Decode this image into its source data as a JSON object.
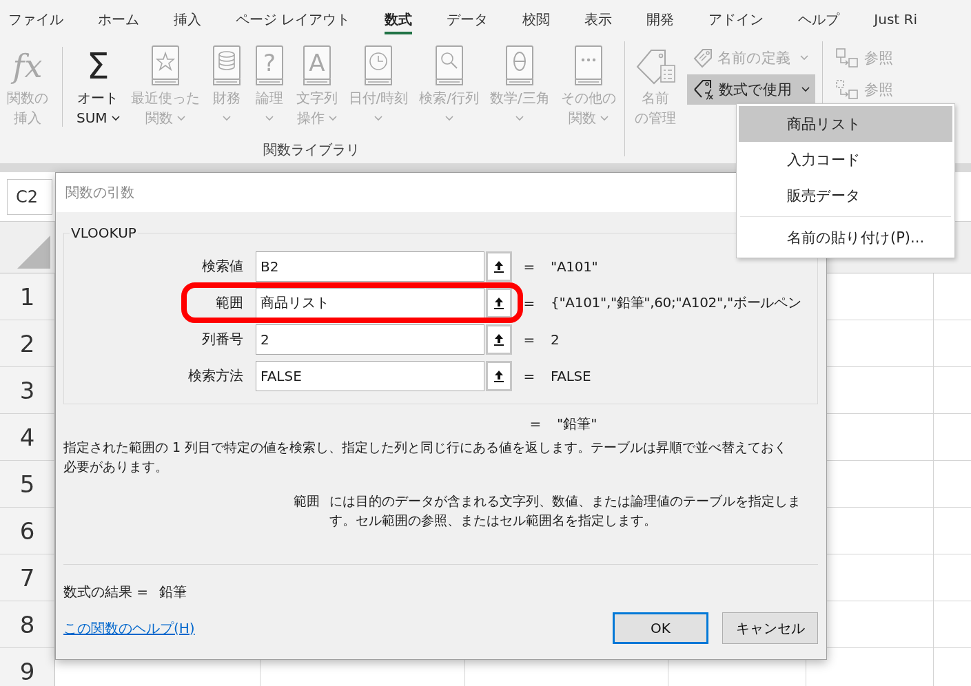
{
  "ribbon_tabs": [
    {
      "label": "ファイル",
      "selected": false
    },
    {
      "label": "ホーム",
      "selected": false
    },
    {
      "label": "挿入",
      "selected": false
    },
    {
      "label": "ページ レイアウト",
      "selected": false
    },
    {
      "label": "数式",
      "selected": true
    },
    {
      "label": "データ",
      "selected": false
    },
    {
      "label": "校閲",
      "selected": false
    },
    {
      "label": "表示",
      "selected": false
    },
    {
      "label": "開発",
      "selected": false
    },
    {
      "label": "アドイン",
      "selected": false
    },
    {
      "label": "ヘルプ",
      "selected": false
    },
    {
      "label": "Just Ri",
      "selected": false
    }
  ],
  "ribbon_groups": [
    {
      "label": "関数ライブラリ",
      "commands": [
        {
          "kind": "large",
          "glyph": "fx",
          "lines": [
            "関数の",
            "挿入"
          ],
          "disabled": true,
          "dropdown": false,
          "pressed": false,
          "separator_after": true
        },
        {
          "kind": "large",
          "glyph": "Σ",
          "lines": [
            "オート",
            "SUM"
          ],
          "disabled": false,
          "dropdown": true,
          "pressed": false,
          "separator_after": false
        },
        {
          "kind": "large",
          "lines": [
            "最近使った",
            "関数"
          ],
          "disabled": true,
          "dropdown": true,
          "pressed": false,
          "separator_after": false
        },
        {
          "kind": "large",
          "lines": [
            "財務"
          ],
          "disabled": true,
          "dropdown": true,
          "pressed": false,
          "separator_after": false
        },
        {
          "kind": "large",
          "glyph": "?",
          "lines": [
            "論理"
          ],
          "disabled": true,
          "dropdown": true,
          "pressed": false,
          "separator_after": false
        },
        {
          "kind": "large",
          "glyph": "A",
          "lines": [
            "文字列",
            "操作"
          ],
          "disabled": true,
          "dropdown": true,
          "pressed": false,
          "separator_after": false
        },
        {
          "kind": "large",
          "lines": [
            "日付/時刻"
          ],
          "disabled": true,
          "dropdown": true,
          "pressed": false,
          "separator_after": false
        },
        {
          "kind": "large",
          "lines": [
            "検索/行列"
          ],
          "disabled": true,
          "dropdown": true,
          "pressed": false,
          "separator_after": false
        },
        {
          "kind": "large",
          "lines": [
            "数学/三角"
          ],
          "disabled": true,
          "dropdown": true,
          "pressed": false,
          "separator_after": false
        },
        {
          "kind": "large",
          "lines": [
            "その他の",
            "関数"
          ],
          "disabled": true,
          "dropdown": true,
          "pressed": false,
          "separator_after": false
        }
      ]
    },
    {
      "commands": [
        {
          "kind": "large",
          "lines": [
            "名前",
            "の管理"
          ],
          "disabled": true,
          "dropdown": false,
          "pressed": false,
          "separator_after": false
        },
        {
          "kind": "small",
          "lines": [
            "名前の定義"
          ],
          "disabled": true,
          "dropdown": true,
          "pressed": false,
          "separator_after": false
        },
        {
          "kind": "small",
          "lines": [
            "数式で使用"
          ],
          "disabled": false,
          "dropdown": true,
          "pressed": true,
          "separator_after": false
        }
      ]
    },
    {
      "commands": [
        {
          "kind": "small",
          "lines": [
            "参照"
          ],
          "disabled": true,
          "dropdown": false,
          "pressed": false,
          "separator_after": false
        },
        {
          "kind": "small",
          "lines": [
            "参照"
          ],
          "disabled": true,
          "dropdown": false,
          "pressed": false,
          "separator_after": false
        }
      ]
    }
  ],
  "sheet": {
    "name_box": "C2",
    "row_numbers": [
      "1",
      "2",
      "3",
      "4",
      "5",
      "6",
      "7",
      "8",
      "9"
    ]
  },
  "dialog": {
    "title": "関数の引数",
    "function_name": "VLOOKUP",
    "arguments": [
      {
        "label": "検索値",
        "value": "B2",
        "equals": "=",
        "result": "\"A101\"",
        "highlighted": false
      },
      {
        "label": "範囲",
        "value": "商品リスト",
        "equals": "=",
        "result": "{\"A101\",\"鉛筆\",60;\"A102\",\"ボールペン",
        "highlighted": true
      },
      {
        "label": "列番号",
        "value": "2",
        "equals": "=",
        "result": "2",
        "highlighted": false
      },
      {
        "label": "検索方法",
        "value": "FALSE",
        "equals": "=",
        "result": "FALSE",
        "highlighted": false
      }
    ],
    "preview_equals": "=",
    "preview_result": "\"鉛筆\"",
    "description": "指定された範囲の 1 列目で特定の値を検索し、指定した列と同じ行にある値を返します。テーブルは昇順で並べ替えておく必要があります。",
    "argument_help": {
      "name": "範囲",
      "text": "には目的のデータが含まれる文字列、数値、または論理値のテーブルを指定します。セル範囲の参照、またはセル範囲名を指定します。"
    },
    "result_label": "数式の結果 =",
    "result_value": "鉛筆",
    "help_link": "この関数のヘルプ(H)",
    "buttons": [
      {
        "label": "OK",
        "default": true
      },
      {
        "label": "キャンセル",
        "default": false
      }
    ]
  },
  "name_menu": {
    "items": [
      {
        "label": "商品リスト",
        "selected": true,
        "separator_before": false
      },
      {
        "label": "入力コード",
        "selected": false,
        "separator_before": false
      },
      {
        "label": "販売データ",
        "selected": false,
        "separator_before": false
      },
      {
        "label": "名前の貼り付け(P)...",
        "selected": false,
        "separator_before": true
      }
    ]
  }
}
